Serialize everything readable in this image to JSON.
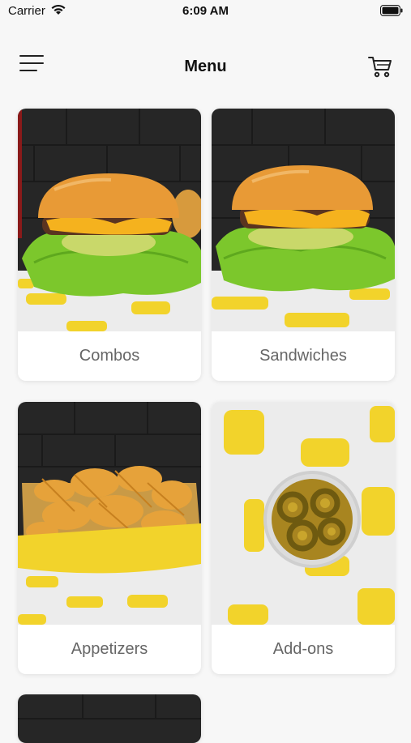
{
  "status_bar": {
    "carrier": "Carrier",
    "time": "6:09 AM"
  },
  "header": {
    "title": "Menu",
    "menu_icon": "hamburger-menu-icon",
    "cart_icon": "shopping-cart-icon"
  },
  "categories": [
    {
      "label": "Combos",
      "image": "burger-photo"
    },
    {
      "label": "Sandwiches",
      "image": "burger-photo"
    },
    {
      "label": "Appetizers",
      "image": "waffle-fries-photo"
    },
    {
      "label": "Add-ons",
      "image": "jalapenos-photo"
    }
  ],
  "colors": {
    "brand_yellow": "#f2d32b",
    "label_gray": "#666666"
  }
}
